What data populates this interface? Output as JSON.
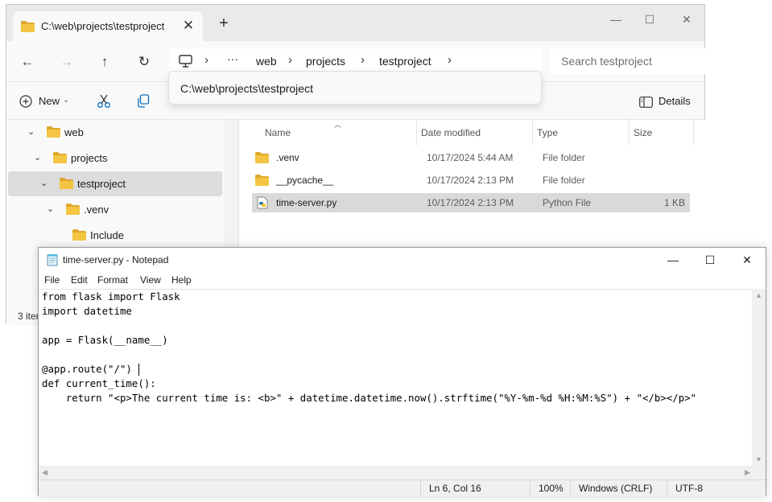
{
  "explorer": {
    "tab_title": "C:\\web\\projects\\testproject",
    "tab_close": "✕",
    "new_tab": "+",
    "window_buttons": {
      "minimize": "—",
      "maximize": "☐",
      "close": "✕"
    },
    "nav": {
      "back": "←",
      "forward": "→",
      "up": "↑",
      "refresh": "↻"
    },
    "breadcrumb": [
      "web",
      "projects",
      "testproject"
    ],
    "breadcrumb_ellipsis": "···",
    "path_dropdown": "C:\\web\\projects\\testproject",
    "search_placeholder": "Search testproject",
    "toolbar": {
      "new_label": "New",
      "details_label": "Details"
    },
    "tree": [
      {
        "label": "web",
        "expanded": true
      },
      {
        "label": "projects",
        "expanded": true
      },
      {
        "label": "testproject",
        "expanded": true,
        "selected": true
      },
      {
        "label": ".venv",
        "expanded": true
      },
      {
        "label": "Include",
        "expanded": false
      }
    ],
    "status": "3 iter",
    "columns": [
      "Name",
      "Date modified",
      "Type",
      "Size"
    ],
    "files": [
      {
        "name": ".venv",
        "date": "10/17/2024 5:44 AM",
        "type": "File folder",
        "size": "",
        "kind": "folder"
      },
      {
        "name": "__pycache__",
        "date": "10/17/2024 2:13 PM",
        "type": "File folder",
        "size": "",
        "kind": "folder"
      },
      {
        "name": "time-server.py",
        "date": "10/17/2024 2:13 PM",
        "type": "Python File",
        "size": "1 KB",
        "kind": "python",
        "selected": true
      }
    ]
  },
  "notepad": {
    "title": "time-server.py - Notepad",
    "window_buttons": {
      "minimize": "—",
      "maximize": "☐",
      "close": "✕"
    },
    "menu": [
      "File",
      "Edit",
      "Format",
      "View",
      "Help"
    ],
    "code_lines": [
      "from flask import Flask",
      "import datetime",
      "",
      "app = Flask(__name__)",
      "",
      "@app.route(\"/\")",
      "def current_time():",
      "    return \"<p>The current time is: <b>\" + datetime.datetime.now().strftime(\"%Y-%m-%d %H:%M:%S\") + \"</b></p>\""
    ],
    "status": {
      "position": "Ln 6, Col 16",
      "zoom": "100%",
      "line_endings": "Windows (CRLF)",
      "encoding": "UTF-8"
    }
  },
  "colors": {
    "folder": "#f3c542",
    "folder_dark": "#e0a82e",
    "selection": "#d9d9d9"
  }
}
